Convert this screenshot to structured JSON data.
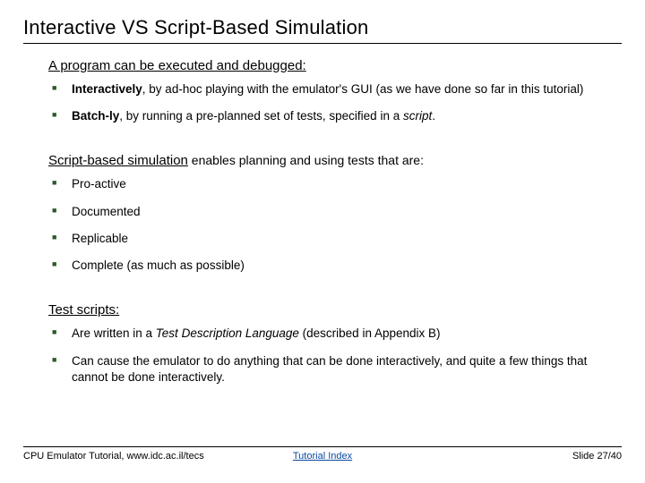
{
  "title": "Interactive VS Script-Based Simulation",
  "section1": {
    "heading": "A program can be executed and debugged:",
    "items": [
      {
        "lead": "Interactively",
        "rest": ", by ad-hoc playing with the emulator's GUI (as we have done so far in this tutorial)"
      },
      {
        "lead": "Batch-ly",
        "rest_a": ", by running a pre-planned set of tests, specified in a ",
        "em": "script",
        "rest_b": "."
      }
    ]
  },
  "section2": {
    "heading": "Script-based simulation",
    "tail": " enables planning and using tests that are:",
    "items": [
      "Pro-active",
      "Documented",
      "Replicable",
      "Complete (as much as possible)"
    ]
  },
  "section3": {
    "heading": "Test scripts:",
    "items": [
      {
        "pre": "Are written in a ",
        "em": "Test Description Language",
        "post": " (described in Appendix B)"
      },
      {
        "text": "Can cause the emulator to do anything that can be done interactively, and quite a few things that cannot be done interactively."
      }
    ]
  },
  "footer": {
    "left": "CPU Emulator Tutorial, www.idc.ac.il/tecs",
    "center": "Tutorial Index",
    "right": "Slide 27/40"
  }
}
